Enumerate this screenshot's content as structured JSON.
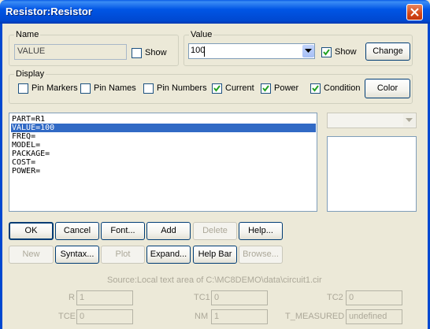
{
  "window": {
    "title": "Resistor:Resistor"
  },
  "name_group": {
    "legend": "Name",
    "value": "VALUE",
    "show_label": "Show",
    "show_checked": false
  },
  "value_group": {
    "legend": "Value",
    "value": "100",
    "show_label": "Show",
    "show_checked": true,
    "change_label": "Change"
  },
  "display_group": {
    "legend": "Display",
    "options": [
      {
        "label": "Pin Markers",
        "checked": false
      },
      {
        "label": "Pin Names",
        "checked": false
      },
      {
        "label": "Pin Numbers",
        "checked": false
      },
      {
        "label": "Current",
        "checked": true
      },
      {
        "label": "Power",
        "checked": true
      },
      {
        "label": "Condition",
        "checked": true
      }
    ],
    "color_label": "Color"
  },
  "attributes": [
    {
      "text": "PART=R1",
      "selected": false
    },
    {
      "text": "VALUE=100",
      "selected": true
    },
    {
      "text": "FREQ=",
      "selected": false
    },
    {
      "text": "MODEL=",
      "selected": false
    },
    {
      "text": "PACKAGE=",
      "selected": false
    },
    {
      "text": "COST=",
      "selected": false
    },
    {
      "text": "POWER=",
      "selected": false
    }
  ],
  "buttons_row1": [
    {
      "label": "OK",
      "enabled": true,
      "default": true
    },
    {
      "label": "Cancel",
      "enabled": true
    },
    {
      "label": "Font...",
      "enabled": true
    },
    {
      "label": "Add",
      "enabled": true
    },
    {
      "label": "Delete",
      "enabled": false
    },
    {
      "label": "Help...",
      "enabled": true
    }
  ],
  "buttons_row2": [
    {
      "label": "New",
      "enabled": false
    },
    {
      "label": "Syntax...",
      "enabled": true
    },
    {
      "label": "Plot",
      "enabled": false
    },
    {
      "label": "Expand...",
      "enabled": true
    },
    {
      "label": "Help Bar",
      "enabled": true
    },
    {
      "label": "Browse...",
      "enabled": false
    }
  ],
  "source_text": "Source:Local text area of C:\\MC8DEMO\\data\\circuit1.cir",
  "params_row1": [
    {
      "label": "R",
      "value": "1"
    },
    {
      "label": "TC1",
      "value": "0"
    },
    {
      "label": "TC2",
      "value": "0"
    }
  ],
  "params_row2": [
    {
      "label": "TCE",
      "value": "0"
    },
    {
      "label": "NM",
      "value": "1"
    },
    {
      "label": "T_MEASURED",
      "value": "undefined"
    }
  ],
  "colors": {
    "title_bar": "#0055e5",
    "selection": "#316ac5",
    "dialog_bg": "#ece9d8"
  }
}
